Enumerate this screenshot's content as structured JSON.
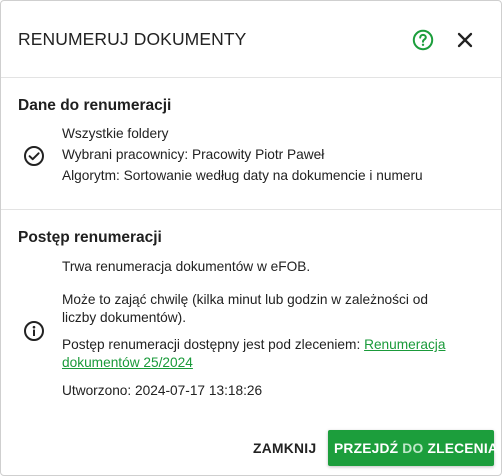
{
  "dialog": {
    "title": "RENUMERUJ DOKUMENTY",
    "help_icon": "help-circle-icon",
    "close_icon": "close-icon",
    "accent_color": "#1c9e3c"
  },
  "params": {
    "title": "Dane do renumeracji",
    "icon": "check-circle-icon",
    "lines": [
      "Wszystkie foldery",
      "Wybrani pracownicy: Pracowity Piotr Paweł",
      "Algorytm: Sortowanie według daty na dokumencie i numeru"
    ]
  },
  "progress": {
    "title": "Postęp renumeracji",
    "icon": "info-circle-icon",
    "status": "Trwa renumeracja dokumentów w eFOB.",
    "note": "Może to zająć chwilę (kilka minut lub godzin w zależności od liczby dokumentów).",
    "available_prefix": "Postęp renumeracji dostępny jest pod zleceniem: ",
    "order_link": "Renumeracja dokumentów 25/2024",
    "created": "Utworzono: 2024-07-17 13:18:26"
  },
  "footer": {
    "close_label": "ZAMKNIJ",
    "goto_label_pre": "PRZEJDŹ ",
    "goto_label_mid": "DO",
    "goto_label_post": " ZLECENIA"
  }
}
